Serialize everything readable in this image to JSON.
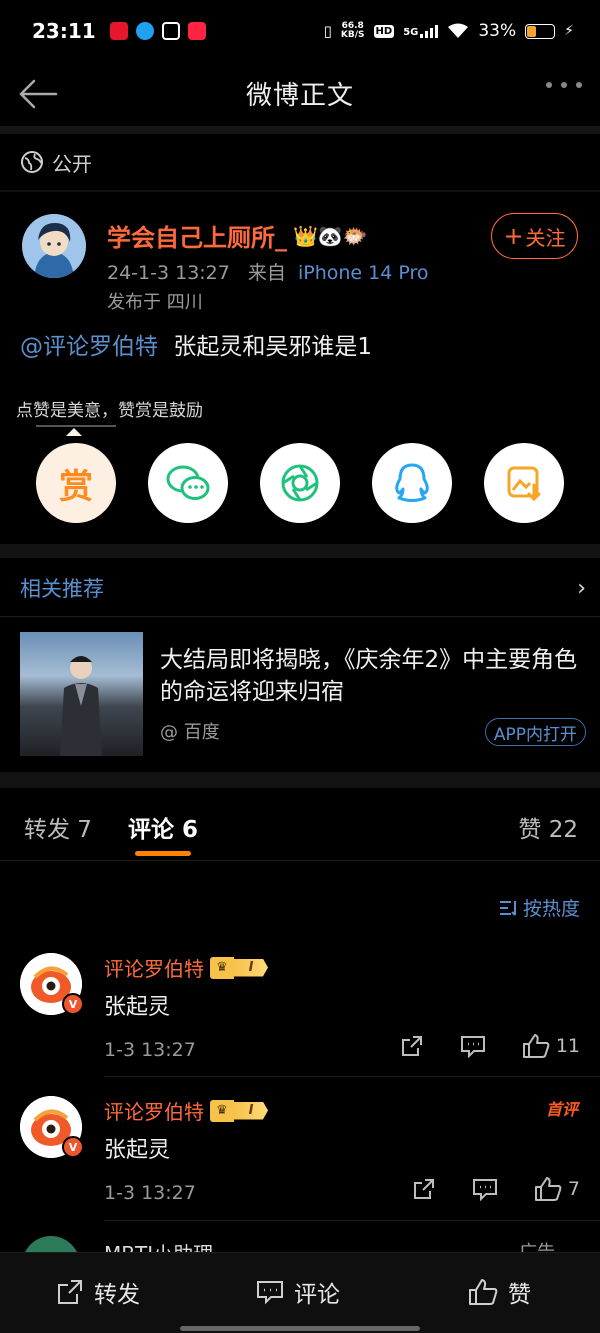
{
  "status_bar": {
    "time": "23:11",
    "net_speed": "66.8",
    "net_unit": "KB/S",
    "hd": "HD",
    "signal": "5G",
    "battery": "33%",
    "battery_level": 0.33
  },
  "nav": {
    "title": "微博正文"
  },
  "visibility": {
    "label": "公开"
  },
  "post": {
    "author": "学会自己上厕所_",
    "author_emojis": "👑🐼🐡",
    "date": "24-1-3 13:27",
    "source_prefix": "来自",
    "device": "iPhone 14 Pro",
    "location": "发布于 四川",
    "follow_label": "关注",
    "mention": "@评论罗伯特",
    "text": "张起灵和吴邪谁是1"
  },
  "reward": {
    "tip": "点赞是美意，赞赏是鼓励",
    "reward_label": "赏",
    "share_targets": [
      "wechat-icon",
      "moments-icon",
      "qq-icon",
      "save-image-icon"
    ]
  },
  "related": {
    "heading": "相关推荐",
    "title": "大结局即将揭晓，《庆余年2》中主要角色的命运将迎来归宿",
    "source": "@ 百度",
    "open_label": "APP内打开"
  },
  "tabs": {
    "repost": "转发 7",
    "comments": "评论 6",
    "likes": "赞 22"
  },
  "sort": {
    "label": "按热度"
  },
  "comments": [
    {
      "name": "评论罗伯特",
      "level": "I",
      "text": "张起灵",
      "time": "1-3 13:27",
      "likes": "11",
      "first": ""
    },
    {
      "name": "评论罗伯特",
      "level": "I",
      "text": "张起灵",
      "time": "1-3 13:27",
      "likes": "7",
      "first": "首评"
    }
  ],
  "peek": {
    "name": "MBTI小助理",
    "ad": "广告"
  },
  "bottom_bar": {
    "repost": "转发",
    "comment": "评论",
    "like": "赞"
  },
  "colors": {
    "accent_orange": "#ff8200",
    "username_orange": "#ff6a3d",
    "link_blue": "#5b8fcf",
    "share_green": "#1fc27a",
    "share_blue": "#23a7f2"
  }
}
